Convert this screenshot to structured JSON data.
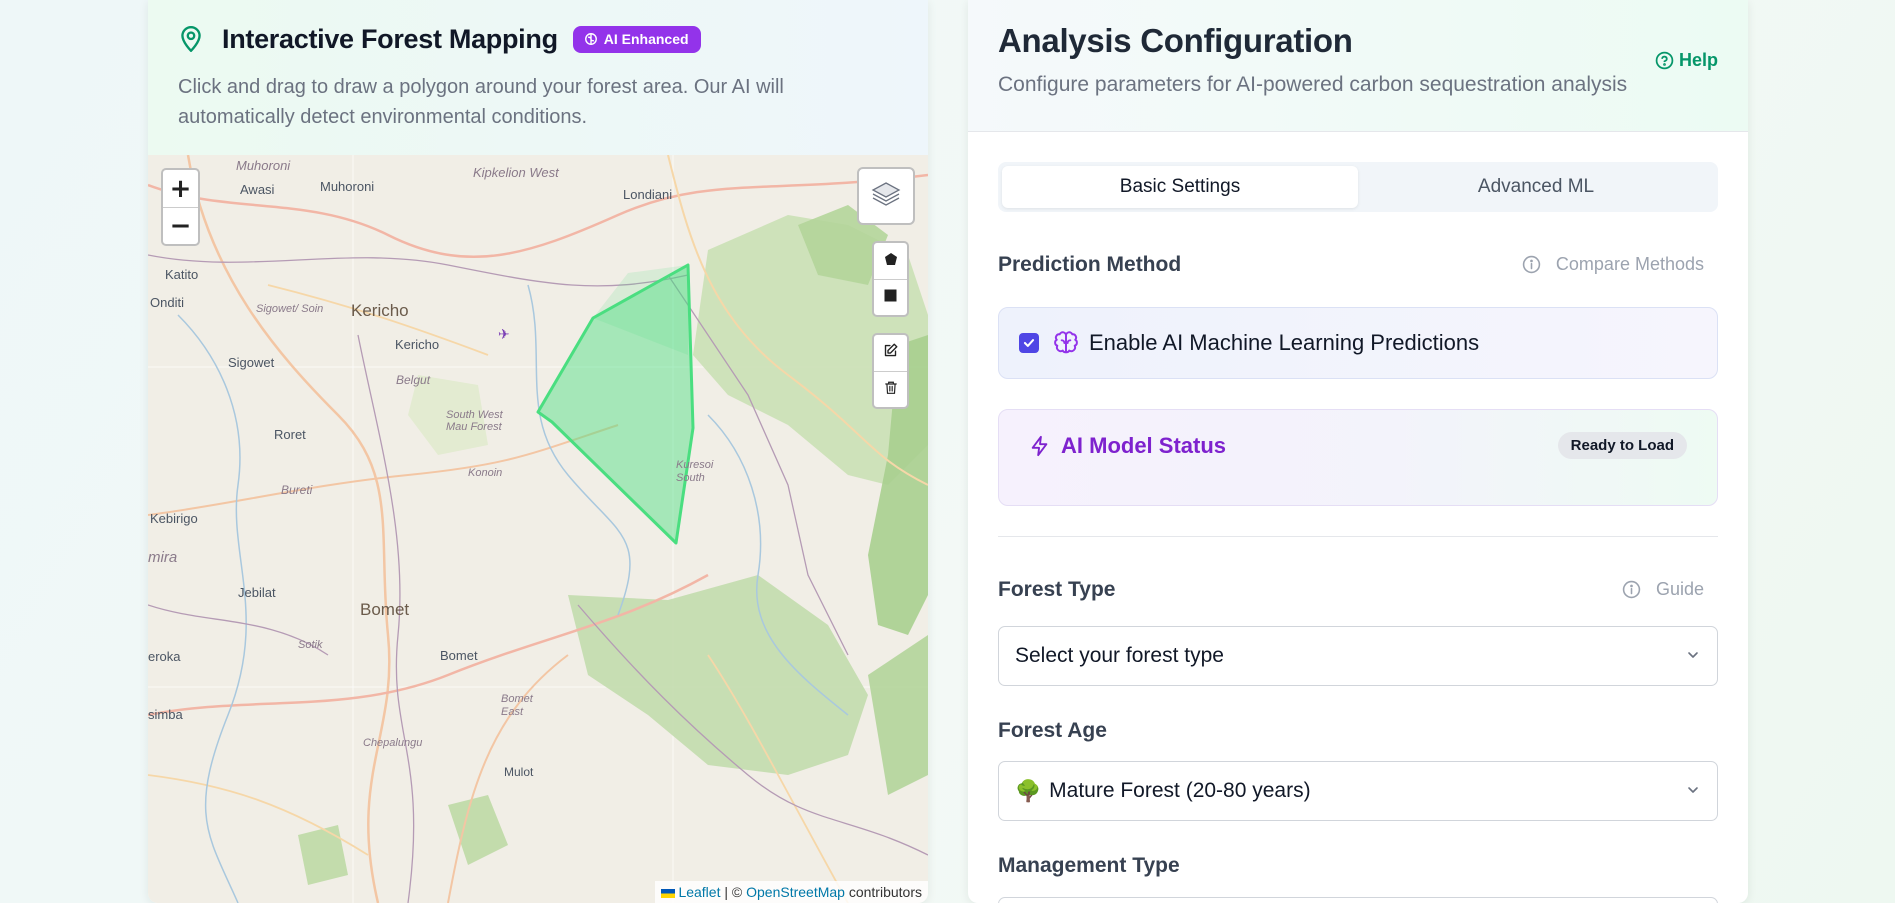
{
  "map_panel": {
    "title": "Interactive Forest Mapping",
    "badge": "AI Enhanced",
    "description": "Click and drag to draw a polygon around your forest area. Our AI will automatically detect environmental conditions.",
    "zoom_in": "+",
    "zoom_out": "−",
    "attribution": {
      "leaflet": "Leaflet",
      "separator": " | © ",
      "osm": "OpenStreetMap",
      "suffix": " contributors"
    },
    "place_labels": [
      "Muhoroni",
      "Awasi",
      "Muhoroni",
      "Kipkelion West",
      "Londiani",
      "Katito",
      "Onditi",
      "Sigowet/ Soin",
      "Kericho",
      "Kericho",
      "Sigowet",
      "Belgut",
      "South West Mau Forest",
      "Roret",
      "Konoin",
      "Kuresoi South",
      "Bureti",
      "Kebirigo",
      "mira",
      "Jebilat",
      "Bomet",
      "Sotik",
      "eroka",
      "Bomet",
      "Bomet East",
      "simba",
      "Chepalungu",
      "Mulot"
    ]
  },
  "config_panel": {
    "title": "Analysis Configuration",
    "subtitle": "Configure parameters for AI-powered carbon sequestration analysis",
    "help": "Help",
    "tabs": [
      {
        "label": "Basic Settings",
        "active": true
      },
      {
        "label": "Advanced ML",
        "active": false
      }
    ],
    "prediction": {
      "label": "Prediction Method",
      "aux": "Compare Methods",
      "checkbox_label": "Enable AI Machine Learning Predictions",
      "checked": true
    },
    "model_status": {
      "title": "AI Model Status",
      "pill": "Ready to Load"
    },
    "forest_type": {
      "label": "Forest Type",
      "aux": "Guide",
      "value": "Select your forest type"
    },
    "forest_age": {
      "label": "Forest Age",
      "value": "Mature Forest (20-80 years)",
      "icon": "tree-icon"
    },
    "management_type": {
      "label": "Management Type"
    }
  },
  "colors": {
    "accent_green": "#059669",
    "badge_purple": "#9333ea",
    "checkbox_indigo": "#4f46e5",
    "polygon_green": "#4ade80"
  }
}
